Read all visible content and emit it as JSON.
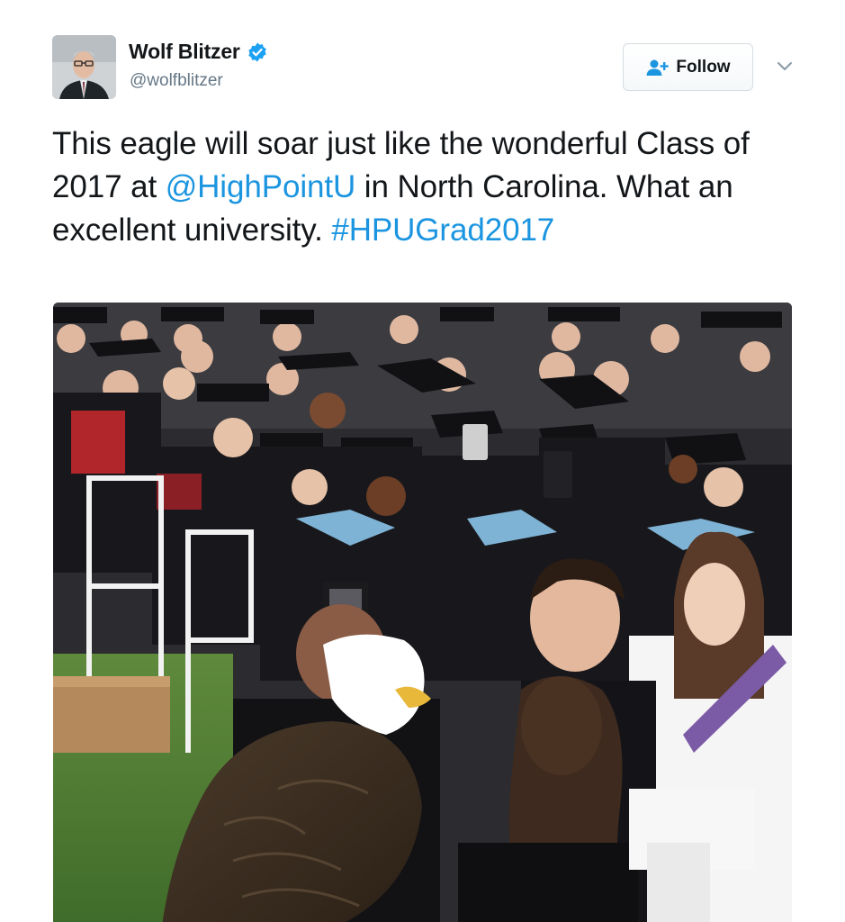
{
  "author": {
    "name": "Wolf Blitzer",
    "handle": "@wolfblitzer",
    "verified_icon": "verified-badge-icon",
    "avatar_icon": "avatar"
  },
  "actions": {
    "follow_label": "Follow",
    "follow_icon": "add-user-icon",
    "menu_icon": "chevron-down-icon"
  },
  "tweet": {
    "text_part1": "This eagle will soar just like the wonderful Class of 2017 at ",
    "mention": "@HighPointU",
    "text_part2": " in North Carolina. What an excellent university. ",
    "hashtag": "#HPUGrad2017"
  },
  "colors": {
    "link": "#1b95e0",
    "verified": "#1da1f2",
    "text": "#14171a",
    "muted": "#657786"
  },
  "media": {
    "type": "photo"
  }
}
